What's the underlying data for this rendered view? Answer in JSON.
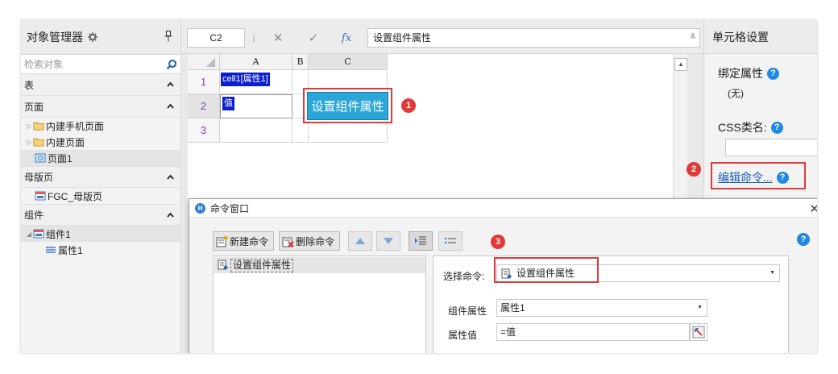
{
  "object_manager": {
    "title": "对象管理器",
    "search_placeholder": "检索对象",
    "sections": {
      "table": "表",
      "pages": "页面",
      "master": "母版页",
      "components": "组件"
    },
    "pages": [
      "内建手机页面",
      "内建页面",
      "页面1"
    ],
    "master_pages": [
      "FGC_母版页"
    ],
    "component": "组件1",
    "component_prop": "属性1"
  },
  "formula_bar": {
    "name_box": "C2",
    "formula": "设置组件属性",
    "fx": "fx"
  },
  "grid": {
    "columns": [
      "A",
      "B",
      "C"
    ],
    "rows": [
      "1",
      "2",
      "3"
    ],
    "a1": "cell1[属性1]",
    "a2": "值",
    "c2_button": "设置组件属性"
  },
  "cell_settings": {
    "title": "单元格设置",
    "bind_label": "绑定属性",
    "bind_value": "(无)",
    "css_label": "CSS类名:",
    "edit_command": "编辑命令..."
  },
  "badges": [
    "1",
    "2",
    "3"
  ],
  "command_window": {
    "title": "命令窗口",
    "new_cmd": "新建命令",
    "delete_cmd": "删除命令",
    "list_item": "设置组件属性",
    "select_cmd_label": "选择命令:",
    "select_cmd_value": "设置组件属性",
    "component_prop_label": "组件属性",
    "component_prop_value": "属性1",
    "prop_value_label": "属性值",
    "prop_value": "=值"
  },
  "colors": {
    "highlight": "#e03a3a",
    "button": "#2aa6d8",
    "chip": "#0b1fd1",
    "link": "#1a5fb4"
  }
}
